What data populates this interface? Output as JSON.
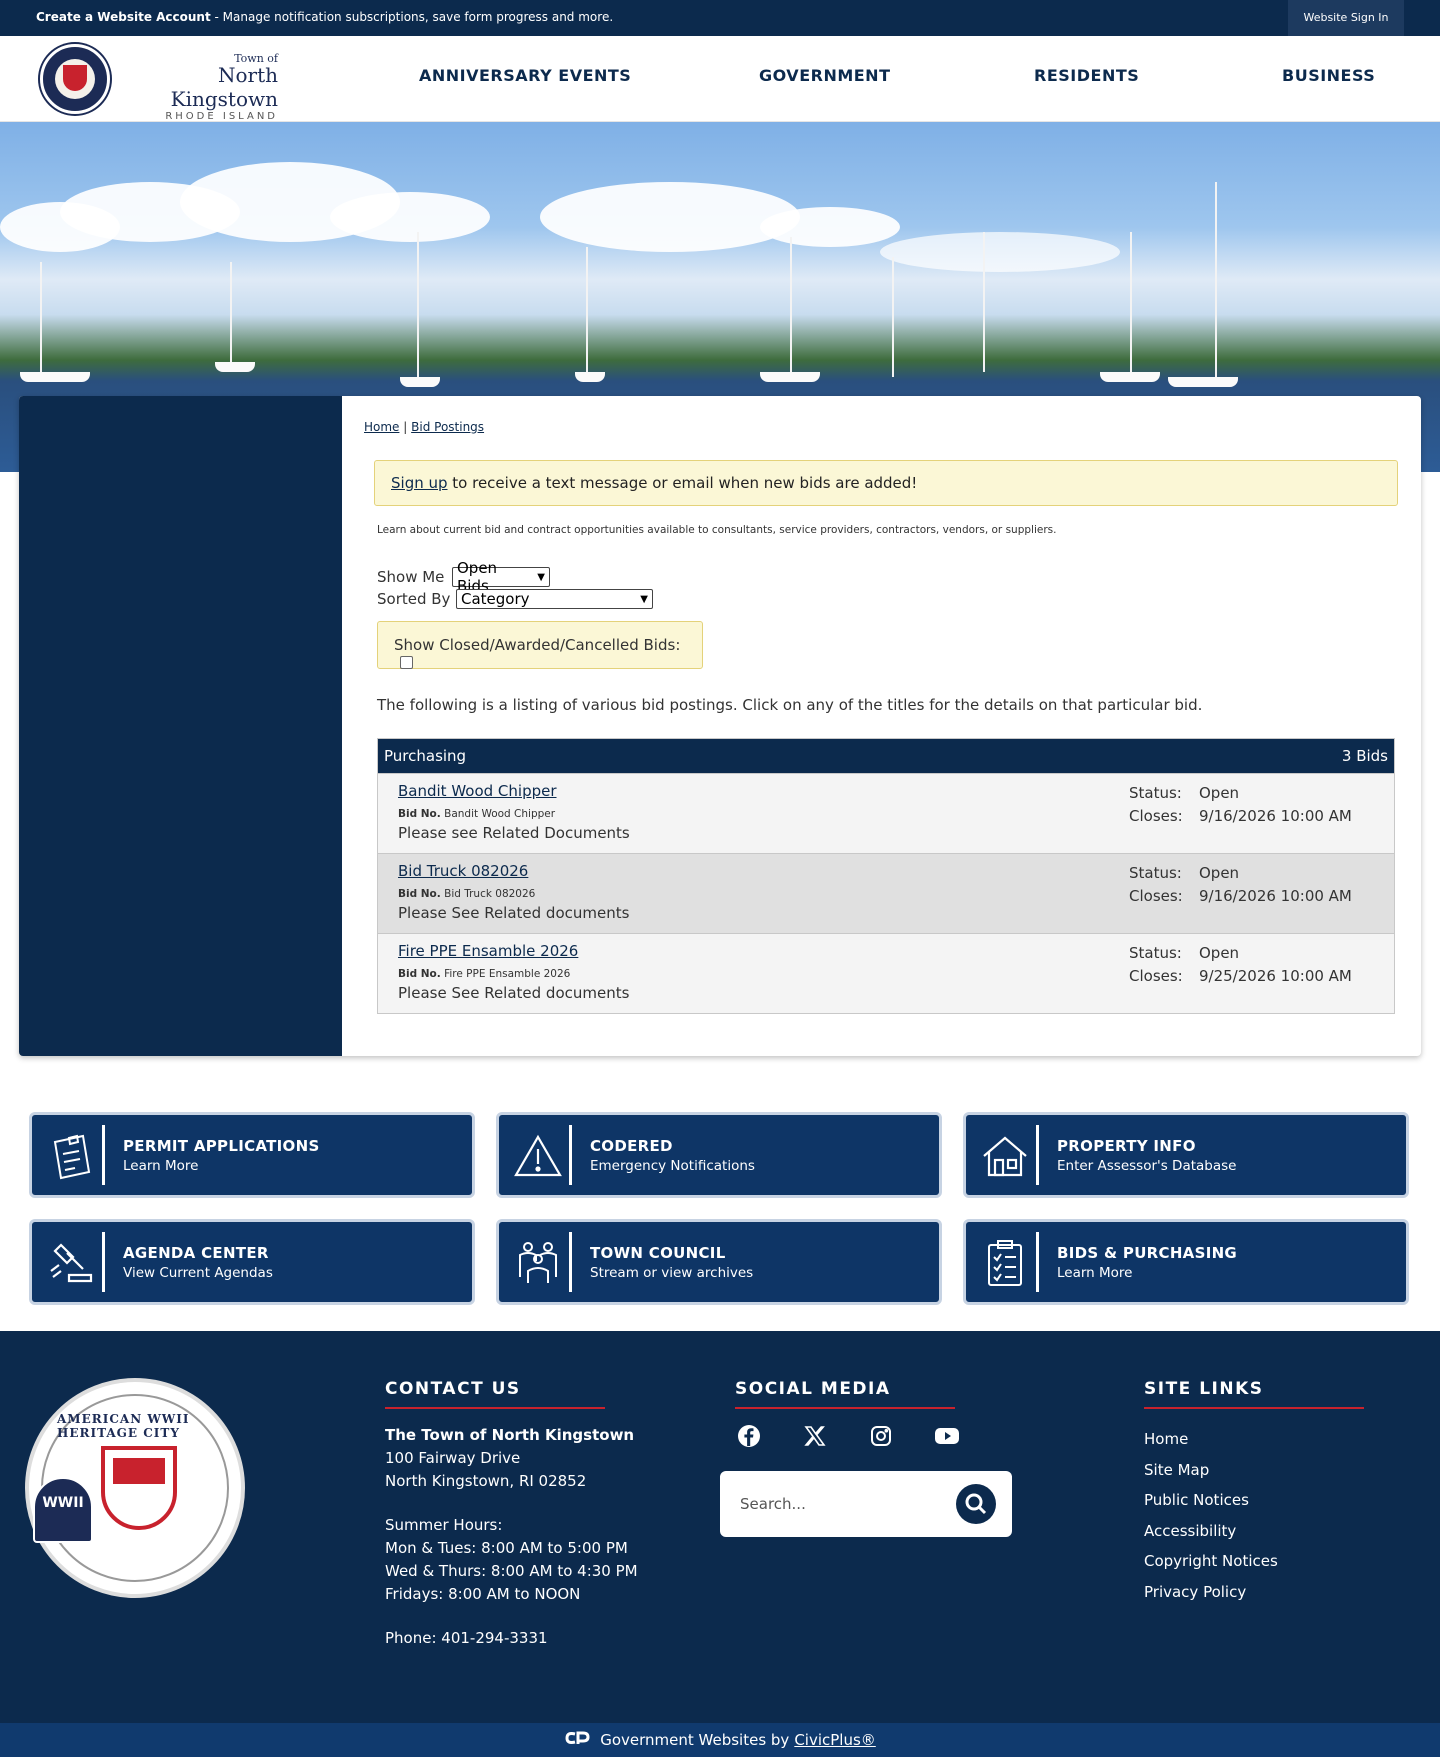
{
  "topbar": {
    "create_account": "Create a Website Account",
    "message": " - Manage notification subscriptions, save form progress and more.",
    "sign_in": "Website Sign In"
  },
  "logo": {
    "town_of": "Town of",
    "name": "North Kingstown",
    "state": "RHODE ISLAND"
  },
  "nav": {
    "items": [
      "ANNIVERSARY EVENTS",
      "GOVERNMENT",
      "RESIDENTS",
      "BUSINESS"
    ]
  },
  "breadcrumb": {
    "home": "Home",
    "separator": "|",
    "current": "Bid Postings"
  },
  "alert": {
    "link": "Sign up",
    "text": " to receive a text message or email when new bids are added!"
  },
  "intro": "Learn about current bid and contract opportunities available to consultants, service providers, contractors, vendors, or suppliers.",
  "filters": {
    "show_me_label": "Show Me",
    "show_me_value": "Open Bids",
    "sorted_by_label": "Sorted By",
    "sorted_by_value": "Category",
    "closed_label": "Show Closed/Awarded/Cancelled Bids:"
  },
  "listing_note": "The following is a listing of various bid postings. Click on any of the titles for the details on that particular bid.",
  "bids": {
    "category": "Purchasing",
    "count": "3 Bids",
    "bid_no_label": "Bid No.",
    "status_label": "Status:",
    "closes_label": "Closes:",
    "items": [
      {
        "title": "Bandit Wood Chipper",
        "bid_no": "Bandit Wood Chipper",
        "description": "Please see Related Documents",
        "status": "Open",
        "closes": "9/16/2026 10:00 AM"
      },
      {
        "title": "Bid Truck 082026",
        "bid_no": "Bid Truck 082026",
        "description": "Please See Related documents",
        "status": "Open",
        "closes": "9/16/2026 10:00 AM"
      },
      {
        "title": "Fire PPE Ensamble 2026",
        "bid_no": "Fire PPE Ensamble 2026",
        "description": "Please See Related documents",
        "status": "Open",
        "closes": "9/25/2026 10:00 AM"
      }
    ]
  },
  "quick_links": [
    {
      "title": "PERMIT APPLICATIONS",
      "subtitle": "Learn More",
      "icon": "permit-clipboard-icon"
    },
    {
      "title": "CODERED",
      "subtitle": "Emergency Notifications",
      "icon": "warning-triangle-icon"
    },
    {
      "title": "PROPERTY INFO",
      "subtitle": "Enter Assessor's Database",
      "icon": "house-icon"
    },
    {
      "title": "AGENDA CENTER",
      "subtitle": "View Current Agendas",
      "icon": "gavel-icon"
    },
    {
      "title": "TOWN COUNCIL",
      "subtitle": "Stream or view archives",
      "icon": "people-icon"
    },
    {
      "title": "BIDS & PURCHASING",
      "subtitle": "Learn More",
      "icon": "checklist-icon"
    }
  ],
  "footer": {
    "seal_text": "AMERICAN WWII HERITAGE CITY",
    "seal_badge": "WWII",
    "contact_heading": "CONTACT US",
    "org_name": "The Town of North Kingstown",
    "address1": "100 Fairway Drive",
    "address2": "North Kingstown, RI 02852",
    "hours_label": "Summer Hours:",
    "hours1": "Mon & Tues: 8:00 AM to 5:00 PM",
    "hours2": "Wed & Thurs: 8:00 AM to 4:30 PM",
    "hours3": "Fridays: 8:00 AM to NOON",
    "phone": "Phone: 401-294-3331",
    "social_heading": "SOCIAL MEDIA",
    "search_placeholder": "Search...",
    "sitelinks_heading": "SITE LINKS",
    "sitelinks": [
      "Home",
      "Site Map",
      "Public Notices",
      "Accessibility",
      "Copyright Notices",
      "Privacy Policy"
    ]
  },
  "bottombar": {
    "text": "Government Websites by",
    "link": "CivicPlus®"
  },
  "colors": {
    "navy": "#0c2a4d",
    "quick_link_bg": "#0e3566",
    "alert_bg": "#fbf7d6",
    "accent_red": "#c8222d"
  }
}
